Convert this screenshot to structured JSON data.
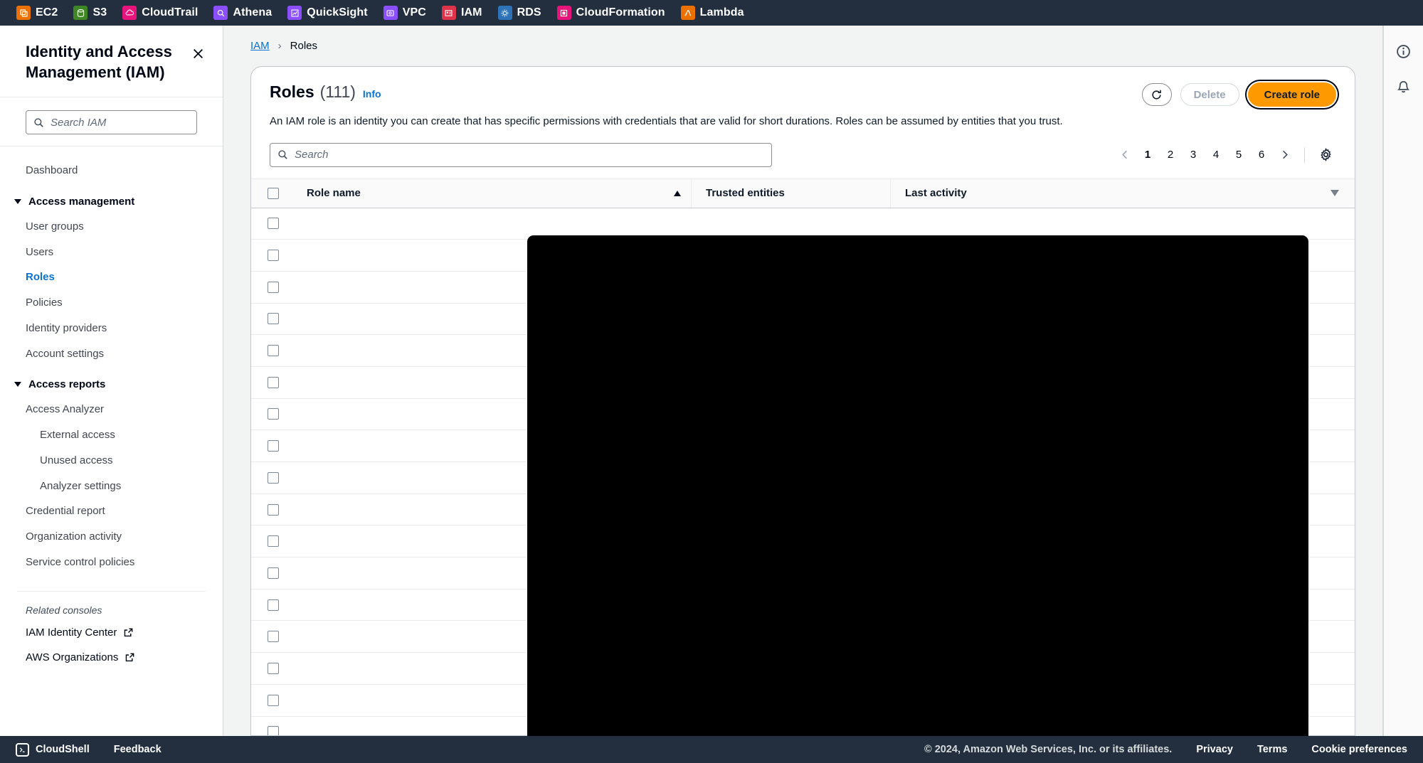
{
  "topbar": {
    "services": [
      {
        "label": "EC2",
        "icon": "ec2-icon",
        "color": "#ED7100"
      },
      {
        "label": "S3",
        "icon": "s3-icon",
        "color": "#3F8624"
      },
      {
        "label": "CloudTrail",
        "icon": "cloudtrail-icon",
        "color": "#E7157B"
      },
      {
        "label": "Athena",
        "icon": "athena-icon",
        "color": "#8C4FFF"
      },
      {
        "label": "QuickSight",
        "icon": "quicksight-icon",
        "color": "#8C4FFF"
      },
      {
        "label": "VPC",
        "icon": "vpc-icon",
        "color": "#8C4FFF"
      },
      {
        "label": "IAM",
        "icon": "iam-icon",
        "color": "#DD344C"
      },
      {
        "label": "RDS",
        "icon": "rds-icon",
        "color": "#2E73B8"
      },
      {
        "label": "CloudFormation",
        "icon": "cloudformation-icon",
        "color": "#E7157B"
      },
      {
        "label": "Lambda",
        "icon": "lambda-icon",
        "color": "#ED7100"
      }
    ]
  },
  "sidebar": {
    "title": "Identity and Access Management (IAM)",
    "close_icon": "close-icon",
    "search": {
      "placeholder": "Search IAM",
      "value": "",
      "icon": "search-icon"
    },
    "dashboard_label": "Dashboard",
    "groups": [
      {
        "label": "Access management",
        "items": [
          {
            "label": "User groups",
            "active": false
          },
          {
            "label": "Users",
            "active": false
          },
          {
            "label": "Roles",
            "active": true
          },
          {
            "label": "Policies",
            "active": false
          },
          {
            "label": "Identity providers",
            "active": false
          },
          {
            "label": "Account settings",
            "active": false
          }
        ]
      },
      {
        "label": "Access reports",
        "items": [
          {
            "label": "Access Analyzer",
            "active": false,
            "sub": false
          },
          {
            "label": "External access",
            "active": false,
            "sub": true
          },
          {
            "label": "Unused access",
            "active": false,
            "sub": true
          },
          {
            "label": "Analyzer settings",
            "active": false,
            "sub": true
          },
          {
            "label": "Credential report",
            "active": false,
            "sub": false
          },
          {
            "label": "Organization activity",
            "active": false,
            "sub": false
          },
          {
            "label": "Service control policies",
            "active": false,
            "sub": false
          }
        ]
      }
    ],
    "related_consoles_label": "Related consoles",
    "related_consoles": [
      {
        "label": "IAM Identity Center",
        "icon": "external-link-icon"
      },
      {
        "label": "AWS Organizations",
        "icon": "external-link-icon"
      }
    ]
  },
  "breadcrumb": {
    "root": "IAM",
    "separator": "›",
    "current": "Roles"
  },
  "page": {
    "title": "Roles",
    "count": "(111)",
    "info_label": "Info",
    "description": "An IAM role is an identity you can create that has specific permissions with credentials that are valid for short durations. Roles can be assumed by entities that you trust.",
    "buttons": {
      "refresh_icon": "refresh-icon",
      "delete_label": "Delete",
      "delete_disabled": true,
      "create_label": "Create role",
      "create_color": "#ff9900"
    },
    "search": {
      "placeholder": "Search",
      "value": "",
      "icon": "search-icon"
    },
    "pagination": {
      "prev_icon": "chevron-left-icon",
      "next_icon": "chevron-right-icon",
      "pages": [
        "1",
        "2",
        "3",
        "4",
        "5",
        "6"
      ],
      "active_page": "1",
      "settings_icon": "gear-icon"
    },
    "table": {
      "select_all_icon": "checkbox-unchecked",
      "columns": [
        {
          "label": "Role name",
          "sort": "ascending"
        },
        {
          "label": "Trusted entities",
          "sort": ""
        },
        {
          "label": "Last activity",
          "sort": ""
        }
      ],
      "preferences_icon": "collapse-icon",
      "row_count": 17,
      "rows_redacted": true
    },
    "redaction": {
      "note": ""
    }
  },
  "right_rail": {
    "buttons": [
      {
        "icon": "info-circle-icon"
      },
      {
        "icon": "notification-icon"
      }
    ]
  },
  "footer": {
    "cloudshell_label": "CloudShell",
    "cloudshell_icon": "terminal-icon",
    "feedback_label": "Feedback",
    "copyright": "© 2024, Amazon Web Services, Inc. or its affiliates.",
    "links": [
      "Privacy",
      "Terms",
      "Cookie preferences"
    ]
  }
}
